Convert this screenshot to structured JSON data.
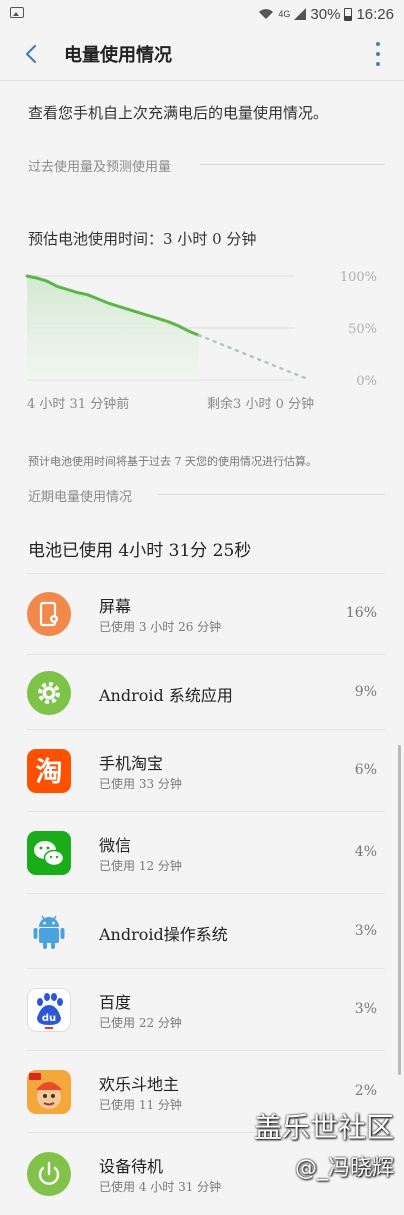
{
  "status_bar": {
    "battery": "30%",
    "time": "16:26",
    "signal": "4G"
  },
  "header": {
    "title": "电量使用情况"
  },
  "intro": "查看您手机自上次充满电后的电量使用情况。",
  "section_past": "过去使用量及预测使用量",
  "estimate": "预估电池使用时间：3 小时 0 分钟",
  "chart_data": {
    "type": "area",
    "x_labels": [
      "4 小时 31 分钟前",
      "剩余3 小时 0 分钟"
    ],
    "y_ticks": [
      "100%",
      "50%",
      "0%"
    ],
    "ylim": [
      0,
      100
    ],
    "grid": true,
    "series": [
      {
        "x": [
          0,
          1,
          2,
          3,
          4,
          5,
          6,
          7,
          8,
          9,
          10,
          11,
          12,
          13,
          14,
          15,
          16,
          17
        ],
        "values": [
          100,
          98,
          95,
          90,
          87,
          84,
          82,
          78,
          74,
          71,
          68,
          65,
          62,
          59,
          56,
          52,
          47,
          43
        ]
      }
    ],
    "projection": {
      "x": [
        17,
        28
      ],
      "values": [
        43,
        0
      ]
    }
  },
  "footnote": "预计电池使用时间将基于过去 7 天您的使用情况进行估算。",
  "section_recent": "近期电量使用情况",
  "battery_used": "电池已使用 4小时 31分 25秒",
  "apps": [
    {
      "name": "屏幕",
      "detail": "已使用 3 小时 26 分钟",
      "percent": "16%",
      "icon": "screen-icon",
      "color": "#f0894b"
    },
    {
      "name": "Android 系统应用",
      "detail": "",
      "percent": "9%",
      "icon": "gear-icon",
      "color": "#7cc348"
    },
    {
      "name": "手机淘宝",
      "detail": "已使用 33 分钟",
      "percent": "6%",
      "icon": "taobao-icon",
      "color": "#ff5000",
      "glyph": "淘"
    },
    {
      "name": "微信",
      "detail": "已使用 12 分钟",
      "percent": "4%",
      "icon": "wechat-icon",
      "color": "#1aad19"
    },
    {
      "name": "Android操作系统",
      "detail": "",
      "percent": "3%",
      "icon": "android-icon",
      "color": "#4aa3df"
    },
    {
      "name": "百度",
      "detail": "已使用 22 分钟",
      "percent": "3%",
      "icon": "baidu-icon",
      "color": "#2d57d8",
      "glyph": "du"
    },
    {
      "name": "欢乐斗地主",
      "detail": "已使用 11 分钟",
      "percent": "2%",
      "icon": "doudizhu-icon",
      "color": "#e84a2a"
    },
    {
      "name": "设备待机",
      "detail": "已使用 4 小时 31 分钟",
      "percent": "2%",
      "icon": "power-icon",
      "color": "#82c24a"
    }
  ],
  "watermark": {
    "line1": "盖乐世社区",
    "line2": "@_冯晓辉"
  }
}
